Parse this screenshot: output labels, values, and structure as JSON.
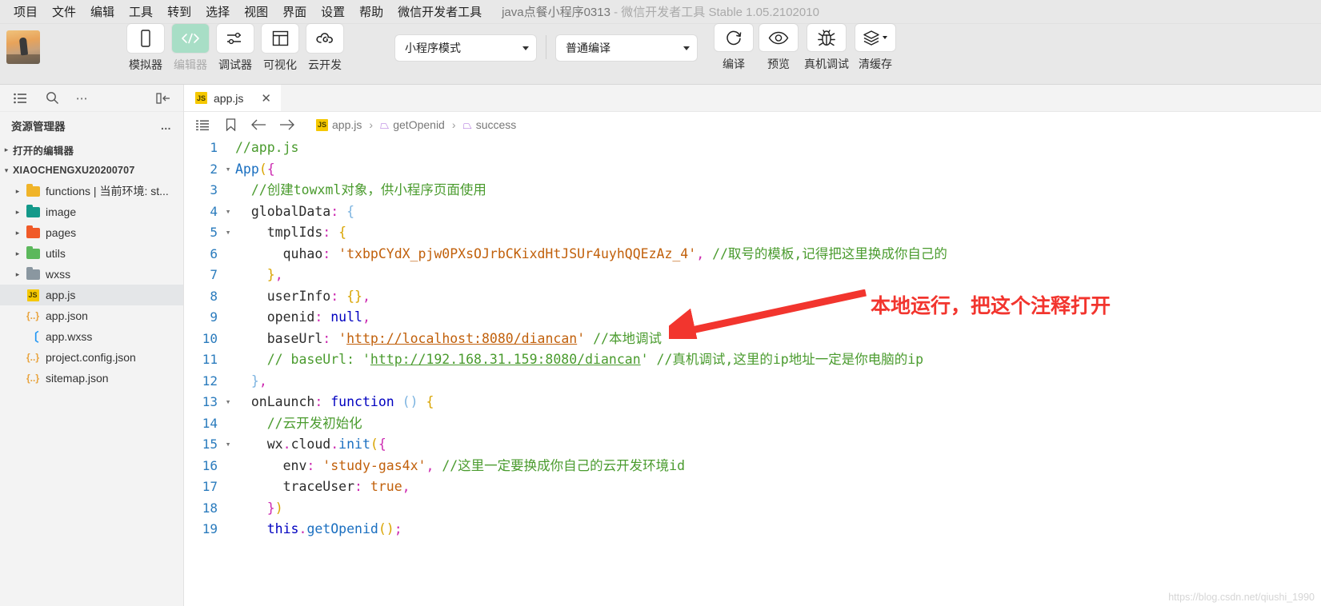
{
  "menu": {
    "items": [
      "项目",
      "文件",
      "编辑",
      "工具",
      "转到",
      "选择",
      "视图",
      "界面",
      "设置",
      "帮助",
      "微信开发者工具"
    ],
    "title_project": "java点餐小程序0313",
    "title_sep": " - ",
    "title_app": "微信开发者工具 Stable 1.05.2102010"
  },
  "toolbar": {
    "buttons": [
      {
        "label": "模拟器",
        "icon": "phone-icon",
        "active": false
      },
      {
        "label": "编辑器",
        "icon": "code-icon",
        "active": true
      },
      {
        "label": "调试器",
        "icon": "sliders-icon",
        "active": false
      },
      {
        "label": "可视化",
        "icon": "layout-icon",
        "active": false
      },
      {
        "label": "云开发",
        "icon": "cloud-icon",
        "active": false
      }
    ],
    "mode_select": "小程序模式",
    "compile_select": "普通编译",
    "right_buttons": [
      {
        "label": "编译",
        "icon": "refresh-icon"
      },
      {
        "label": "预览",
        "icon": "eye-icon"
      },
      {
        "label": "真机调试",
        "icon": "bug-icon"
      },
      {
        "label": "清缓存",
        "icon": "layers-icon"
      }
    ]
  },
  "sidebar": {
    "icons": [
      "list-icon",
      "search-icon",
      "more-icon",
      "collapse-panel-icon"
    ],
    "title": "资源管理器",
    "more_label": "…",
    "open_editors": "打开的编辑器",
    "project_name": "XIAOCHENGXU20200707",
    "tree": [
      {
        "label": "functions | 当前环境: st...",
        "type": "folder",
        "color": "#f0b429",
        "expandable": true,
        "selected": false
      },
      {
        "label": "image",
        "type": "folder",
        "color": "#14998a",
        "expandable": true,
        "selected": false
      },
      {
        "label": "pages",
        "type": "folder",
        "color": "#f05a28",
        "expandable": true,
        "selected": false
      },
      {
        "label": "utils",
        "type": "folder",
        "color": "#5cb85c",
        "expandable": true,
        "selected": false
      },
      {
        "label": "wxss",
        "type": "folder",
        "color": "#8a97a0",
        "expandable": true,
        "selected": false
      },
      {
        "label": "app.js",
        "type": "js",
        "color": "#f5c800",
        "expandable": false,
        "selected": true
      },
      {
        "label": "app.json",
        "type": "json",
        "color": "#e8a33d",
        "expandable": false,
        "selected": false
      },
      {
        "label": "app.wxss",
        "type": "wxss",
        "color": "#2196f3",
        "expandable": false,
        "selected": false
      },
      {
        "label": "project.config.json",
        "type": "json",
        "color": "#e8a33d",
        "expandable": false,
        "selected": false
      },
      {
        "label": "sitemap.json",
        "type": "json",
        "color": "#e8a33d",
        "expandable": false,
        "selected": false
      }
    ]
  },
  "editor": {
    "tab": {
      "label": "app.js",
      "icon": "js-file-icon",
      "close": "✕"
    },
    "breadcrumb": {
      "icons": [
        "outline-icon",
        "bookmark-icon",
        "back-arrow-icon",
        "forward-arrow-icon"
      ],
      "items": [
        "app.js",
        "getOpenid",
        "success"
      ],
      "separator": "›"
    }
  },
  "code": {
    "lines": [
      {
        "n": "1",
        "fold": "",
        "html": "<span class='cmt'>//app.js</span>"
      },
      {
        "n": "2",
        "fold": "v",
        "html": "<span class='fn'>App</span><span class='punc-y'>(</span><span class='punc-p'>{</span>"
      },
      {
        "n": "3",
        "fold": "",
        "html": "  <span class='cmt'>//创建towxml对象，供小程序页面使用</span>"
      },
      {
        "n": "4",
        "fold": "v",
        "html": "  <span class='prop'>globalData</span><span class='colon'>:</span> <span class='punc-b'>{</span>"
      },
      {
        "n": "5",
        "fold": "v",
        "html": "    <span class='prop'>tmplIds</span><span class='colon'>:</span> <span class='punc-y'>{</span>"
      },
      {
        "n": "6",
        "fold": "",
        "html": "      <span class='prop'>quhao</span><span class='colon'>:</span> <span class='str'>'txbpCYdX_pjw0PXsOJrbCKixdHtJSUr4uyhQQEzAz_4'</span><span class='punc-p'>,</span> <span class='cmt'>//取号的模板,记得把这里换成你自己的</span>"
      },
      {
        "n": "7",
        "fold": "",
        "html": "    <span class='punc-y'>}</span><span class='punc-p'>,</span>"
      },
      {
        "n": "8",
        "fold": "",
        "html": "    <span class='prop'>userInfo</span><span class='colon'>:</span> <span class='punc-y'>{}</span><span class='punc-p'>,</span>"
      },
      {
        "n": "9",
        "fold": "",
        "html": "    <span class='prop'>openid</span><span class='colon'>:</span> <span class='kw'>null</span><span class='punc-p'>,</span>"
      },
      {
        "n": "10",
        "fold": "",
        "html": "    <span class='prop'>baseUrl</span><span class='colon'>:</span> <span class='str'>'</span><span class='lnk-o'>http://localhost:8080/diancan</span><span class='str'>'</span> <span class='cmt'>//本地调试</span>"
      },
      {
        "n": "11",
        "fold": "",
        "html": "    <span class='cmt'>// baseUrl: '</span><span class='lnk-g'>http://192.168.31.159:8080/diancan</span><span class='cmt'>' //真机调试,这里的ip地址一定是你电脑的ip</span>"
      },
      {
        "n": "12",
        "fold": "",
        "html": "  <span class='punc-b'>}</span><span class='punc-p'>,</span>"
      },
      {
        "n": "13",
        "fold": "v",
        "html": "  <span class='prop'>onLaunch</span><span class='colon'>:</span> <span class='kw'>function</span> <span class='punc-b'>()</span> <span class='punc-y'>{</span>"
      },
      {
        "n": "14",
        "fold": "",
        "html": "    <span class='cmt'>//云开发初始化</span>"
      },
      {
        "n": "15",
        "fold": "v",
        "html": "    <span class='id'>wx</span><span class='punc-p'>.</span><span class='id'>cloud</span><span class='punc-p'>.</span><span class='fn'>init</span><span class='punc-y'>(</span><span class='punc-p'>{</span>"
      },
      {
        "n": "16",
        "fold": "",
        "html": "      <span class='prop'>env</span><span class='colon'>:</span> <span class='str'>'study-gas4x'</span><span class='punc-p'>,</span> <span class='cmt'>//这里一定要换成你自己的云开发环境id</span>"
      },
      {
        "n": "17",
        "fold": "",
        "html": "      <span class='prop'>traceUser</span><span class='colon'>:</span> <span class='str'>true</span><span class='punc-p'>,</span>"
      },
      {
        "n": "18",
        "fold": "",
        "html": "    <span class='punc-p'>}</span><span class='punc-y'>)</span>"
      },
      {
        "n": "19",
        "fold": "",
        "html": "    <span class='kw'>this</span><span class='punc-p'>.</span><span class='fn'>getOpenid</span><span class='punc-y'>()</span><span class='punc-p'>;</span>"
      }
    ]
  },
  "annotation": {
    "text": "本地运行，把这个注释打开",
    "color": "#f2352e",
    "arrow": "arrow-pointing-left"
  },
  "watermark": "https://blog.csdn.net/qiushi_1990"
}
